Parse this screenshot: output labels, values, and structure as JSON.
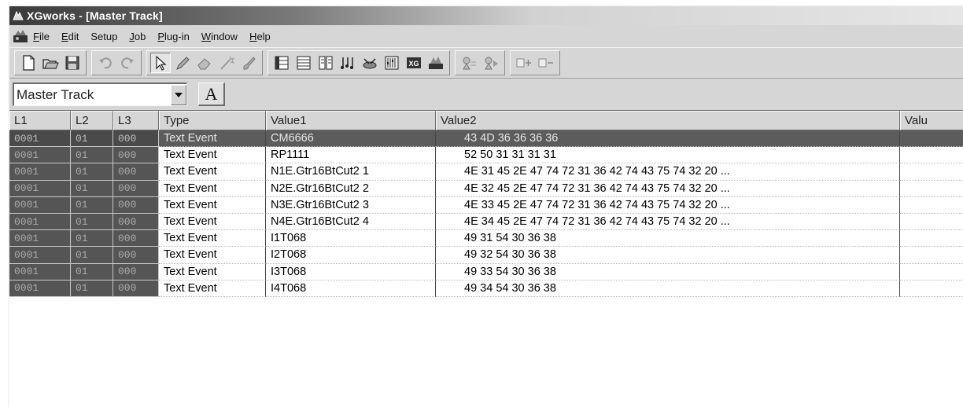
{
  "window": {
    "title": "XGworks - [Master Track]"
  },
  "menu": {
    "items": [
      {
        "u": "F",
        "rest": "ile"
      },
      {
        "u": "E",
        "rest": "dit"
      },
      {
        "u": "",
        "rest": "Setup"
      },
      {
        "u": "J",
        "rest": "ob"
      },
      {
        "u": "P",
        "rest": "lug-in"
      },
      {
        "u": "W",
        "rest": "indow"
      },
      {
        "u": "H",
        "rest": "elp"
      }
    ]
  },
  "toolbar": {
    "groups": [
      [
        "new-file-icon",
        "open-folder-icon",
        "save-disk-icon"
      ],
      [
        "undo-icon",
        "redo-icon"
      ],
      [
        "select-arrow-icon",
        "pencil-icon",
        "eraser-icon",
        "magic-wand-icon",
        "brush-icon"
      ],
      [
        "track-view-icon",
        "piano-roll-icon",
        "event-list-icon",
        "score-icon",
        "drum-editor-icon",
        "mixer-icon",
        "xg-editor-icon",
        "voice-editor-icon"
      ],
      [
        "record-icon",
        "play-icon"
      ],
      [
        "zoom-in-icon",
        "zoom-out-icon"
      ]
    ]
  },
  "trackbar": {
    "track_select_value": "Master Track",
    "font_button_label": "A"
  },
  "grid": {
    "columns": [
      "L1",
      "L2",
      "L3",
      "Type",
      "Value1",
      "Value2",
      "Valu"
    ],
    "rows": [
      {
        "l1": "0001",
        "l2": "01",
        "l3": "000",
        "type": "Text Event",
        "value1": "CM6666",
        "value2": "43 4D 36 36 36 36",
        "selected": true
      },
      {
        "l1": "0001",
        "l2": "01",
        "l3": "000",
        "type": "Text Event",
        "value1": "RP1111",
        "value2": "52 50 31 31 31 31"
      },
      {
        "l1": "0001",
        "l2": "01",
        "l3": "000",
        "type": "Text Event",
        "value1": "N1E.Gtr16BtCut2 1",
        "value2": "4E 31 45 2E 47 74 72 31 36 42 74 43 75 74 32 20 ..."
      },
      {
        "l1": "0001",
        "l2": "01",
        "l3": "000",
        "type": "Text Event",
        "value1": "N2E.Gtr16BtCut2 2",
        "value2": "4E 32 45 2E 47 74 72 31 36 42 74 43 75 74 32 20 ..."
      },
      {
        "l1": "0001",
        "l2": "01",
        "l3": "000",
        "type": "Text Event",
        "value1": "N3E.Gtr16BtCut2 3",
        "value2": "4E 33 45 2E 47 74 72 31 36 42 74 43 75 74 32 20 ..."
      },
      {
        "l1": "0001",
        "l2": "01",
        "l3": "000",
        "type": "Text Event",
        "value1": "N4E.Gtr16BtCut2 4",
        "value2": "4E 34 45 2E 47 74 72 31 36 42 74 43 75 74 32 20 ..."
      },
      {
        "l1": "0001",
        "l2": "01",
        "l3": "000",
        "type": "Text Event",
        "value1": "I1T068",
        "value2": "49 31 54 30 36 38"
      },
      {
        "l1": "0001",
        "l2": "01",
        "l3": "000",
        "type": "Text Event",
        "value1": "I2T068",
        "value2": "49 32 54 30 36 38"
      },
      {
        "l1": "0001",
        "l2": "01",
        "l3": "000",
        "type": "Text Event",
        "value1": "I3T068",
        "value2": "49 33 54 30 36 38"
      },
      {
        "l1": "0001",
        "l2": "01",
        "l3": "000",
        "type": "Text Event",
        "value1": "I4T068",
        "value2": "49 34 54 30 36 38"
      }
    ]
  }
}
